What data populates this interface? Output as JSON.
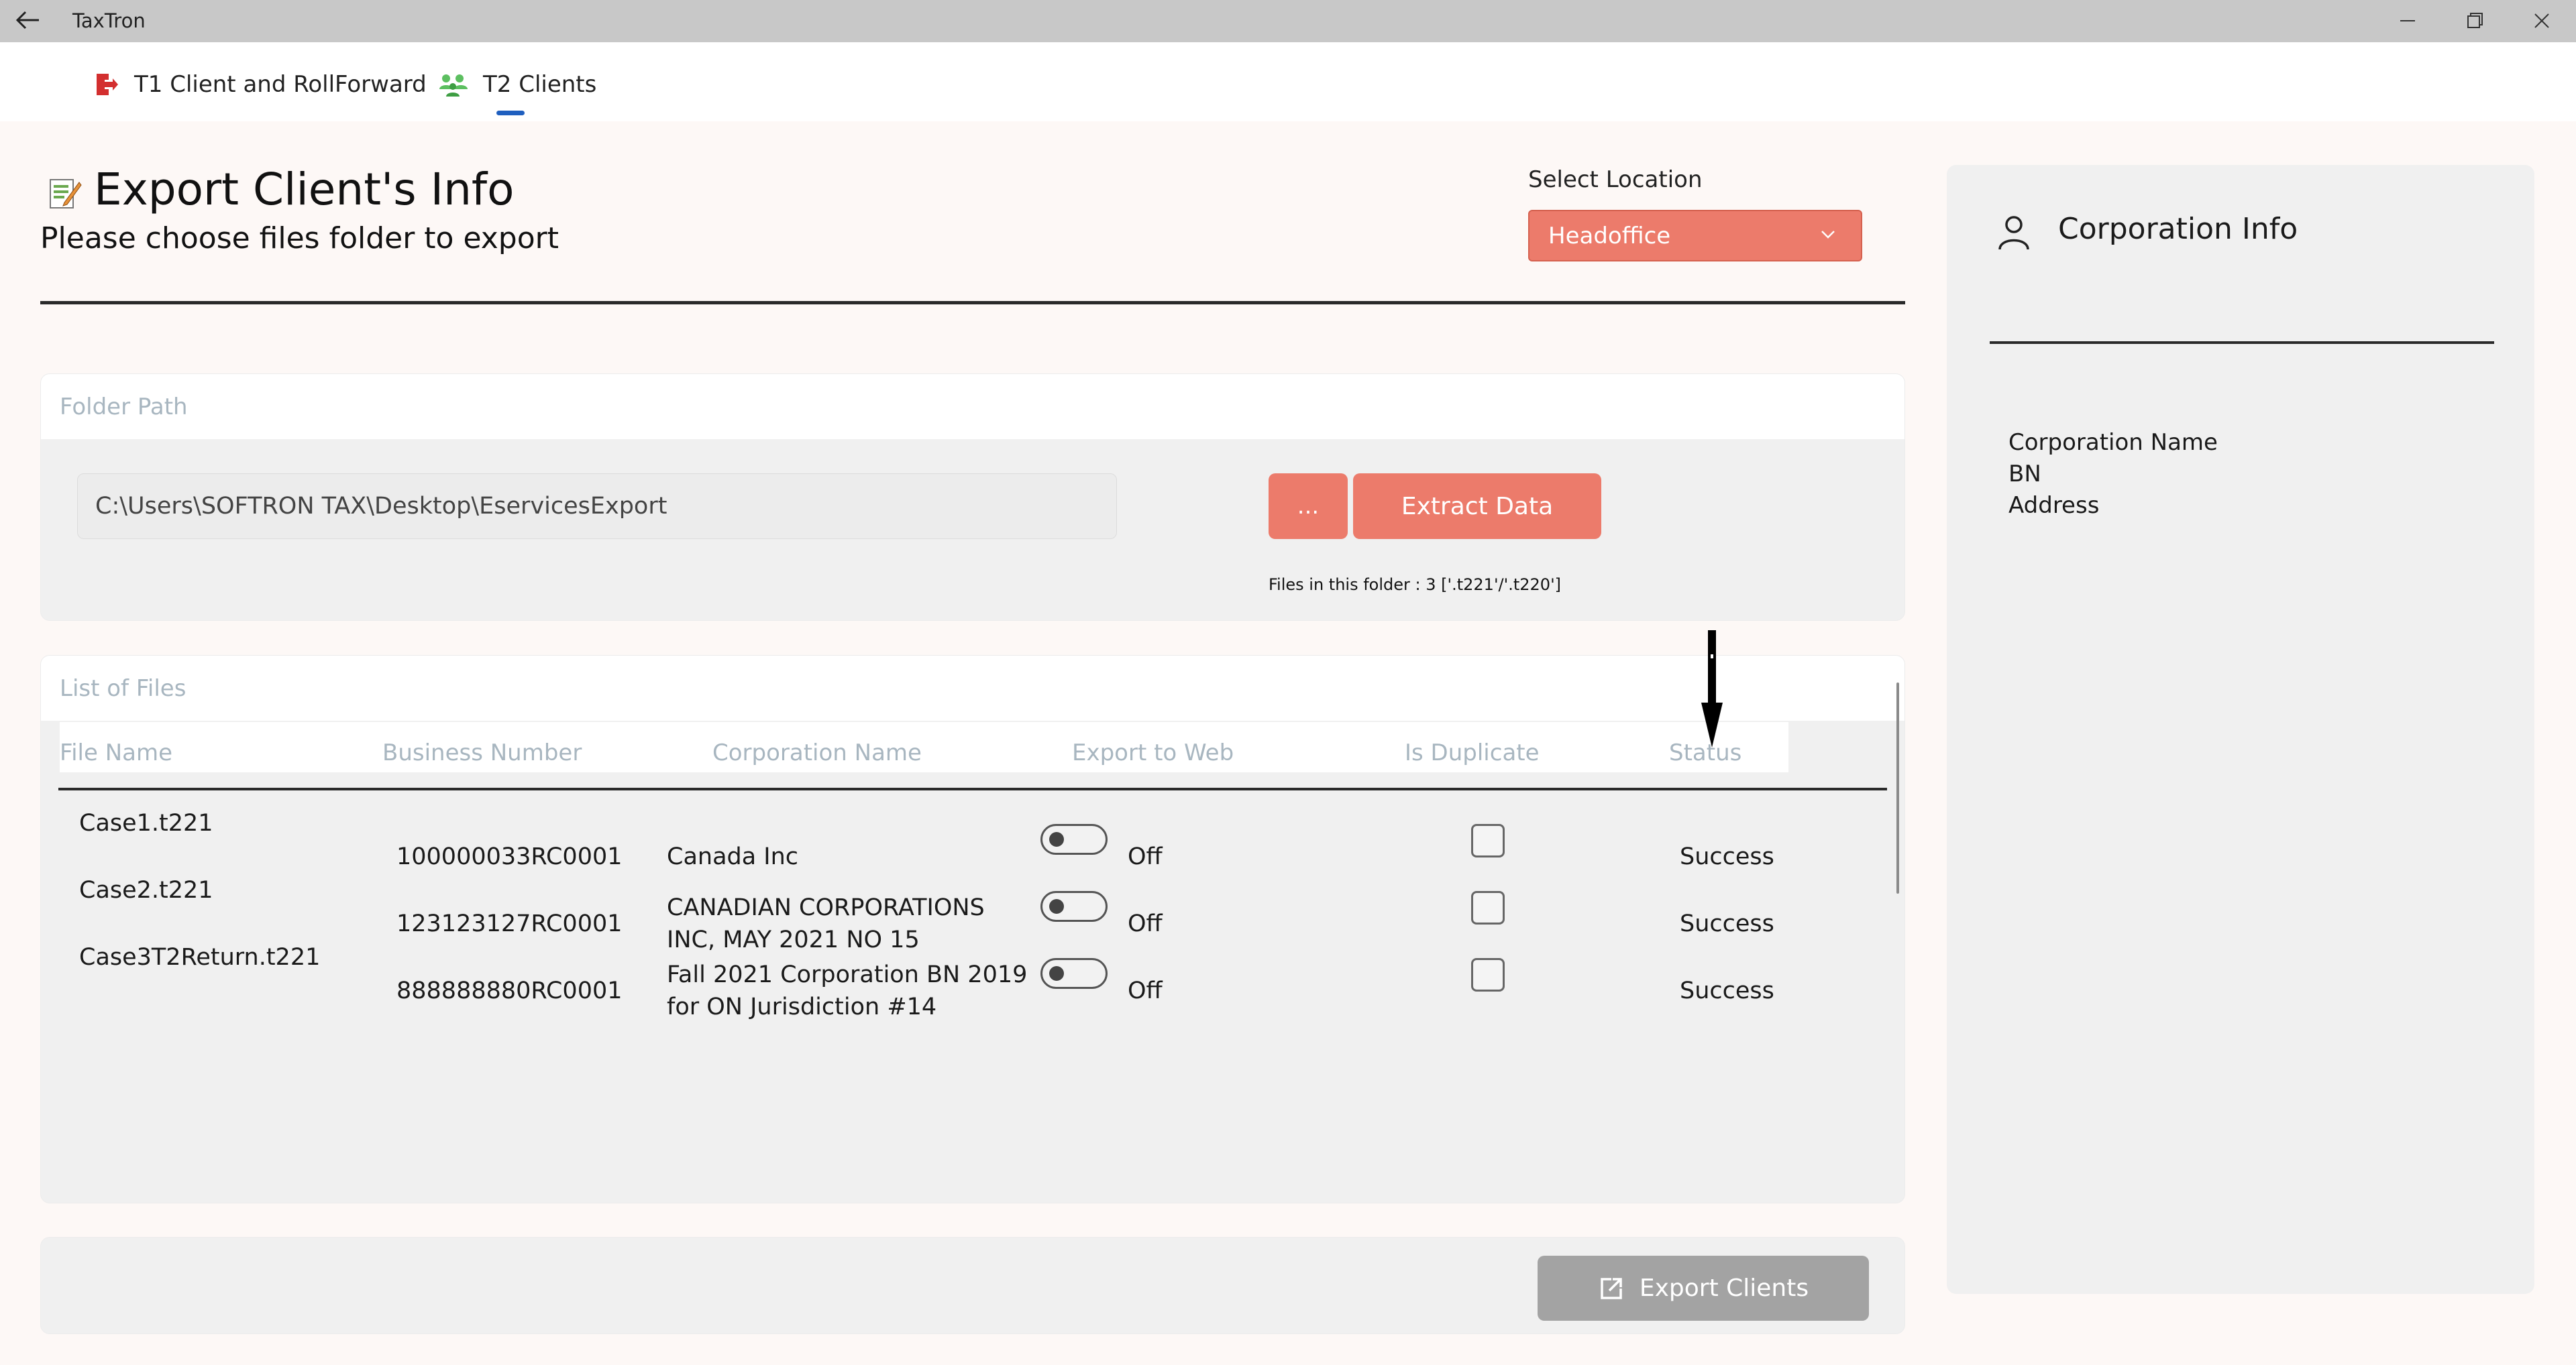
{
  "window": {
    "title": "TaxTron"
  },
  "nav": {
    "tabs": [
      {
        "label": "T1 Client and RollForward",
        "icon": "exit-doc-icon",
        "color": "#d32f2f"
      },
      {
        "label": "T2 Clients",
        "icon": "users-group-icon",
        "color": "#4caf50",
        "selected": true
      }
    ]
  },
  "header": {
    "title": "Export Client's Info",
    "subtitle": "Please choose files folder to export",
    "location_label": "Select Location",
    "location_value": "Headoffice"
  },
  "folder": {
    "heading": "Folder Path",
    "path": "C:\\Users\\SOFTRON TAX\\Desktop\\EservicesExport",
    "browse_label": "...",
    "extract_label": "Extract Data",
    "files_note": "Files in this folder : 3 ['.t221'/'.t220']"
  },
  "files": {
    "heading": "List of Files",
    "columns": [
      "File Name",
      "Business Number",
      "Corporation Name",
      "Export to Web",
      "Is Duplicate",
      "Status"
    ],
    "rows": [
      {
        "file": "Case1.t221",
        "bn": "100000033RC0001",
        "corp": [
          "Canada Inc"
        ],
        "export": "Off",
        "status": "Success"
      },
      {
        "file": "Case2.t221",
        "bn": "123123127RC0001",
        "corp": [
          "CANADIAN CORPORATIONS",
          "INC, MAY 2021 NO 15"
        ],
        "export": "Off",
        "status": "Success"
      },
      {
        "file": "Case3T2Return.t221",
        "bn": "888888880RC0001",
        "corp": [
          "Fall 2021 Corporation BN 2019",
          "for ON Jurisdiction #14"
        ],
        "export": "Off",
        "status": "Success"
      }
    ]
  },
  "footer": {
    "export_label": "Export Clients"
  },
  "corp_info": {
    "title": "Corporation Info",
    "fields": [
      "Corporation Name",
      "BN",
      "Address"
    ]
  },
  "colors": {
    "accent": "#ec7b6b",
    "disabled": "#a3a3a3",
    "selected_tab": "#1f5fbf"
  }
}
